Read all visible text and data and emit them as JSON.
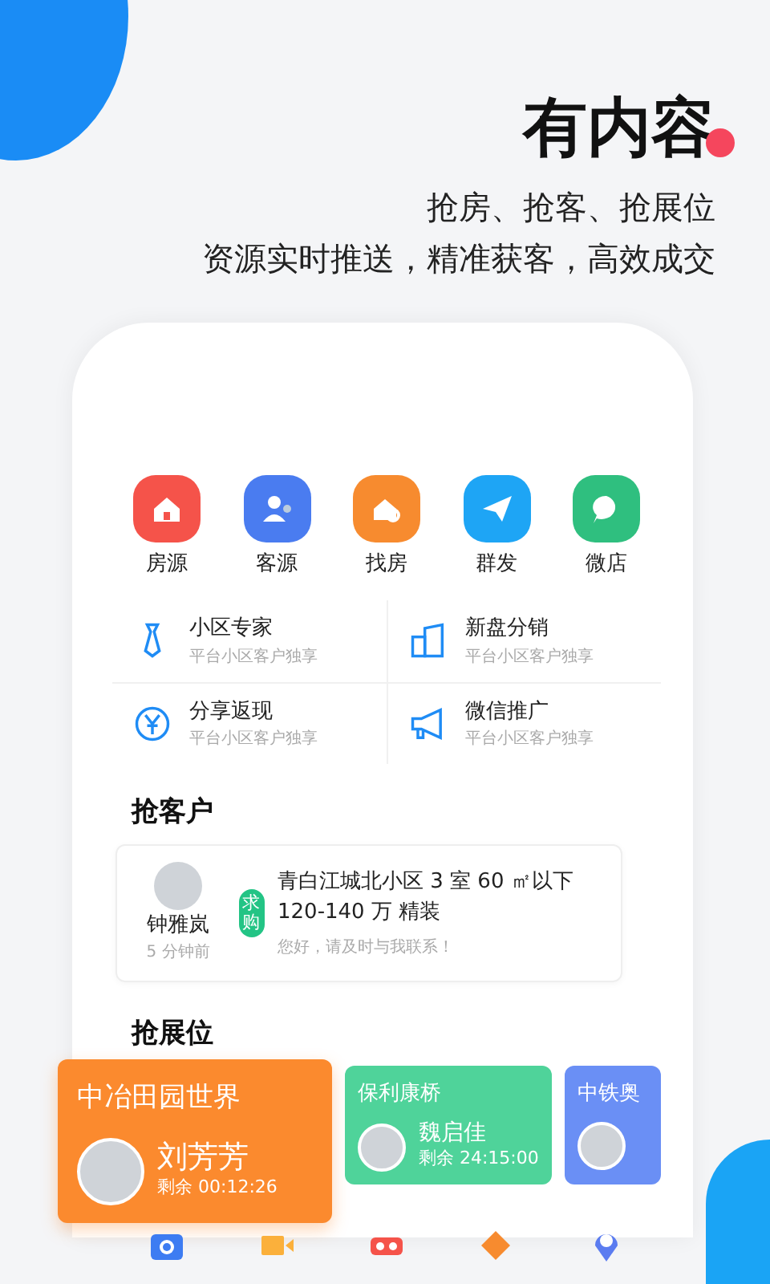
{
  "headline": {
    "title": "有内容",
    "line_1": "抢房、抢客、抢展位",
    "line_2": "资源实时推送，精准获客，高效成交"
  },
  "shortcuts": [
    {
      "label": "房源",
      "color": "#f5534a",
      "kind": "house"
    },
    {
      "label": "客源",
      "color": "#4a7cf0",
      "kind": "people"
    },
    {
      "label": "找房",
      "color": "#f78b2f",
      "kind": "search"
    },
    {
      "label": "群发",
      "color": "#1ea5f5",
      "kind": "send"
    },
    {
      "label": "微店",
      "color": "#2fbf7f",
      "kind": "chat"
    }
  ],
  "services": [
    {
      "title": "小区专家",
      "subtitle": "平台小区客户独享",
      "kind": "tie"
    },
    {
      "title": "新盘分销",
      "subtitle": "平台小区客户独享",
      "kind": "building"
    },
    {
      "title": "分享返现",
      "subtitle": "平台小区客户独享",
      "kind": "yen"
    },
    {
      "title": "微信推广",
      "subtitle": "平台小区客户独享",
      "kind": "megaphone"
    }
  ],
  "customers": {
    "heading": "抢客户",
    "items": [
      {
        "name": "钟雅岚",
        "time": "5 分钟前",
        "tag": "求购",
        "request": "青白江城北小区 3 室 60 ㎡以下 120-140 万 精装",
        "message": "您好，请及时与我联系！"
      }
    ]
  },
  "booths": {
    "heading": "抢展位",
    "items": [
      {
        "title": "中冶田园世界",
        "agent": "刘芳芳",
        "remaining": "剩余 00:12:26",
        "color": "#fb8a2e",
        "featured": true
      },
      {
        "title": "保利康桥",
        "agent": "魏启佳",
        "remaining": "剩余 24:15:00",
        "color": "#4fd39a",
        "featured": false
      },
      {
        "title": "中铁奥",
        "color": "#6a8ff5",
        "featured": false
      }
    ]
  }
}
